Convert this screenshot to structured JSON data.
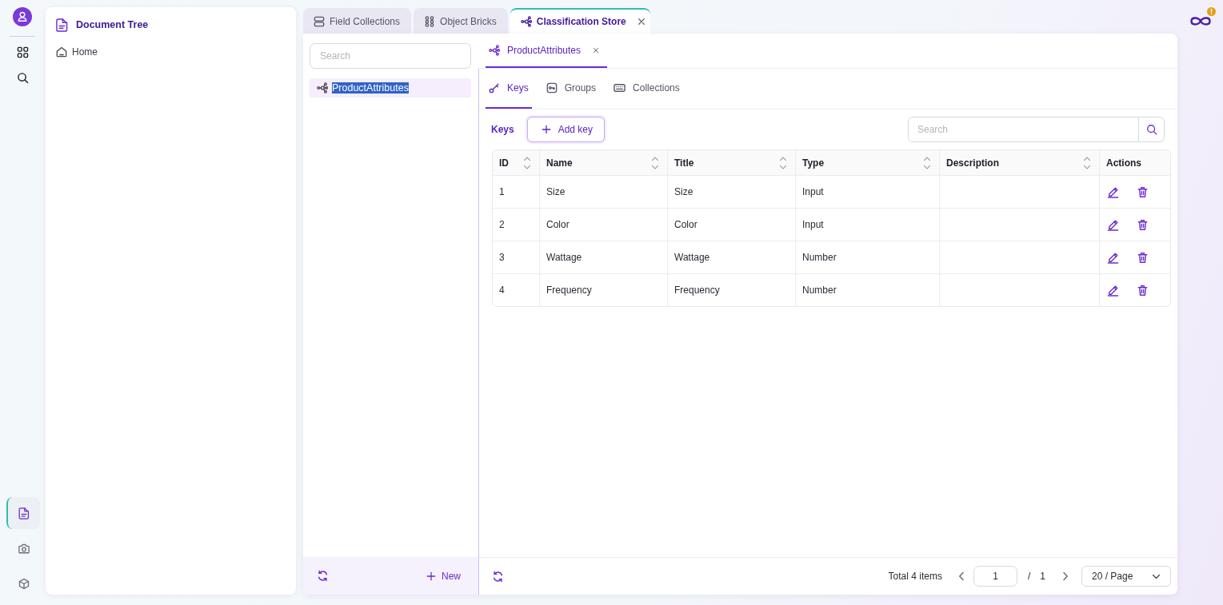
{
  "rail": {
    "bottom_items": [
      {
        "selected": true
      },
      {
        "selected": false
      },
      {
        "selected": false
      }
    ]
  },
  "document_tree": {
    "title": "Document Tree",
    "items": [
      {
        "label": "Home"
      }
    ]
  },
  "editor_tabs": [
    {
      "label": "Field Collections",
      "selected": false,
      "closable": false
    },
    {
      "label": "Object Bricks",
      "selected": false,
      "closable": false
    },
    {
      "label": "Classification Store",
      "selected": true,
      "closable": true
    }
  ],
  "store_tree": {
    "search": {
      "placeholder": "Search"
    },
    "items": [
      {
        "label": "ProductAttributes",
        "selected": true,
        "text_selected": true
      }
    ],
    "new_button": "New"
  },
  "store_editor": {
    "tab": {
      "label": "ProductAttributes",
      "selected": true,
      "closable": true
    },
    "subtabs": [
      {
        "label": "Keys",
        "selected": true
      },
      {
        "label": "Groups",
        "selected": false
      },
      {
        "label": "Collections",
        "selected": false
      }
    ],
    "toolbar": {
      "title": "Keys",
      "add_button": "Add key",
      "search": {
        "placeholder": "Search"
      }
    },
    "table": {
      "columns": [
        {
          "label": "ID",
          "sortable": true
        },
        {
          "label": "Name",
          "sortable": true
        },
        {
          "label": "Title",
          "sortable": true
        },
        {
          "label": "Type",
          "sortable": true
        },
        {
          "label": "Description",
          "sortable": true
        },
        {
          "label": "Actions",
          "sortable": false
        }
      ],
      "rows": [
        {
          "id": "1",
          "name": "Size",
          "title": "Size",
          "type": "Input"
        },
        {
          "id": "2",
          "name": "Color",
          "title": "Color",
          "type": "Input"
        },
        {
          "id": "3",
          "name": "Wattage",
          "title": "Wattage",
          "type": "Number"
        },
        {
          "id": "4",
          "name": "Frequency",
          "title": "Frequency",
          "type": "Number"
        }
      ]
    },
    "pagination": {
      "total": "Total 4 items",
      "page": "1",
      "separator": "/",
      "pages": "1",
      "page_size": "20 / Page"
    }
  }
}
